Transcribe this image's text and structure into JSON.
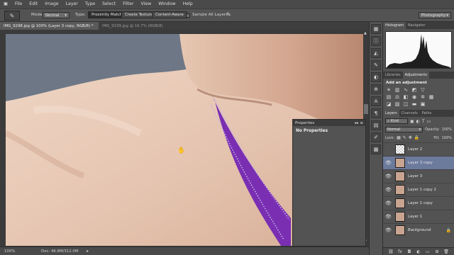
{
  "menu": [
    "File",
    "Edit",
    "Image",
    "Layer",
    "Type",
    "Select",
    "Filter",
    "View",
    "Window",
    "Help"
  ],
  "options": {
    "mode_label": "Mode:",
    "mode_value": "Normal",
    "type_label": "Type:",
    "btn_proximity": "Proximity Match",
    "btn_create_texture": "Create Texture",
    "btn_content_aware": "Content-Aware",
    "sample_all_layers": "Sample All Layers",
    "workspace": "Photography"
  },
  "tabs": [
    {
      "label": "IMG_9298.jpg @ 100% (Layer 3 copy, RGB/8) *",
      "active": true
    },
    {
      "label": "IMG_9339.jpg @ 16.7% (RGB/8)",
      "active": false
    }
  ],
  "status": {
    "zoom": "100%",
    "doc": "Doc: 46.8M/312.0M"
  },
  "properties": {
    "title": "Properties",
    "body": "No Properties"
  },
  "right_panel": {
    "top_tabs": [
      "Histogram",
      "Navigator"
    ],
    "adj_tabs": [
      "Libraries",
      "Adjustments"
    ],
    "adj_title": "Add an adjustment",
    "layer_tabs": [
      "Layers",
      "Channels",
      "Paths"
    ],
    "kind": "Kind",
    "blend": "Normal",
    "opacity_label": "Opacity:",
    "opacity": "100%",
    "lock_label": "Lock:",
    "fill_label": "Fill:",
    "fill": "100%",
    "layers": [
      {
        "name": "Layer 2",
        "checker": true,
        "visible": false,
        "selected": false,
        "italic": false
      },
      {
        "name": "Layer 3 copy",
        "checker": false,
        "visible": true,
        "selected": true,
        "italic": false
      },
      {
        "name": "Layer 3",
        "checker": false,
        "visible": true,
        "selected": false,
        "italic": false
      },
      {
        "name": "Layer 1 copy 2",
        "checker": false,
        "visible": true,
        "selected": false,
        "italic": false
      },
      {
        "name": "Layer 1 copy",
        "checker": false,
        "visible": true,
        "selected": false,
        "italic": false
      },
      {
        "name": "Layer 1",
        "checker": false,
        "visible": true,
        "selected": false,
        "italic": false
      },
      {
        "name": "Background",
        "checker": false,
        "visible": true,
        "selected": false,
        "italic": true
      }
    ]
  },
  "colors": {
    "canvas_bg_gray": "#6d7786",
    "skin_light": "#e2c4b0",
    "skin_shadow": "#c59a83",
    "strap_purple": "#7a2fb3",
    "accent_selected": "#6c7a9c"
  },
  "icons": [
    "brush-icon",
    "histogram-icon",
    "navigator-icon",
    "adjustments-icon",
    "layers-icon",
    "eye-icon"
  ]
}
